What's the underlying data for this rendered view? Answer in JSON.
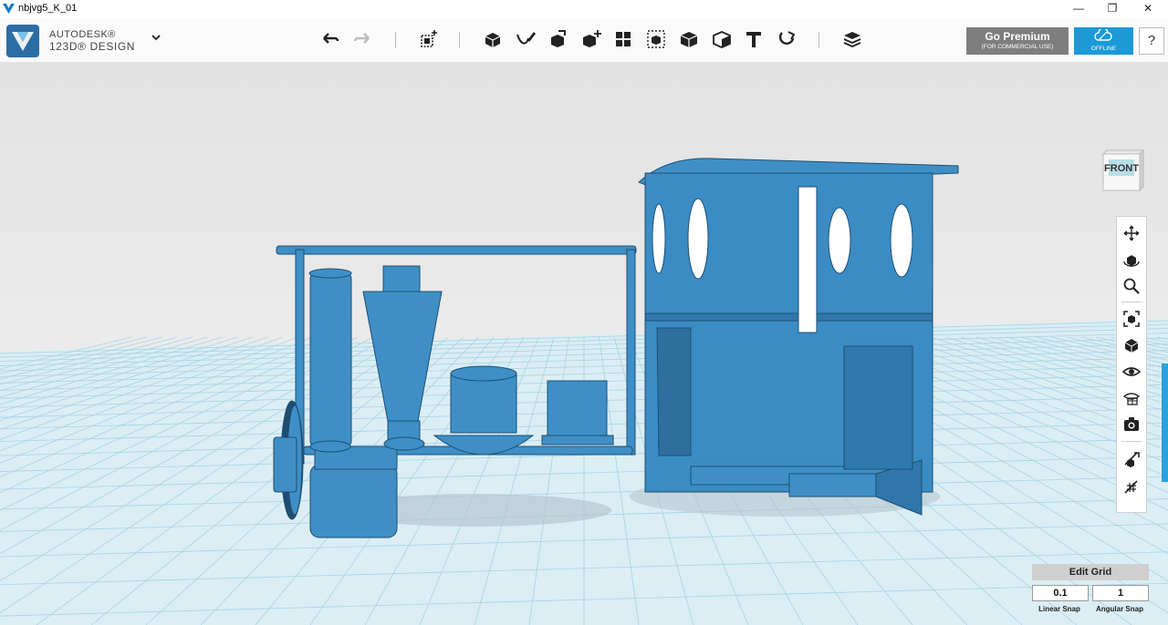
{
  "window": {
    "title": "nbjvg5_K_01",
    "controls": [
      "—",
      "❐",
      "✕"
    ]
  },
  "brand": {
    "line1": "AUTODESK®",
    "line2": "123D® DESIGN"
  },
  "toolbar": {
    "tools": [
      "undo-icon",
      "redo-icon",
      "primitives-icon",
      "sketch-icon",
      "construct-icon",
      "modify-icon",
      "pattern-icon",
      "group-icon",
      "combine-icon",
      "measure-icon",
      "material-icon",
      "text-icon",
      "snap-icon",
      "layers-icon"
    ]
  },
  "premium": {
    "title": "Go Premium",
    "subtitle": "(FOR COMMERCIAL USE)"
  },
  "offline": {
    "label": "OFFLINE"
  },
  "help": {
    "label": "?"
  },
  "viewcube": {
    "label": "FRONT"
  },
  "navbar": {
    "tools": [
      "pan-icon",
      "orbit-icon",
      "zoom-icon",
      "fit-icon",
      "view-mode-icon",
      "visibility-icon",
      "materials-icon",
      "screenshot-icon",
      "snap-toggle-icon",
      "grid-toggle-icon"
    ]
  },
  "edit_grid": {
    "title": "Edit Grid",
    "linear_value": "0.1",
    "angular_value": "1",
    "linear_label": "Linear Snap",
    "angular_label": "Angular Snap"
  },
  "colors": {
    "accent": "#1b9ad6",
    "model": "#3f8fc6",
    "grid": "#a9d3e4",
    "premium": "#7e7e7e"
  }
}
